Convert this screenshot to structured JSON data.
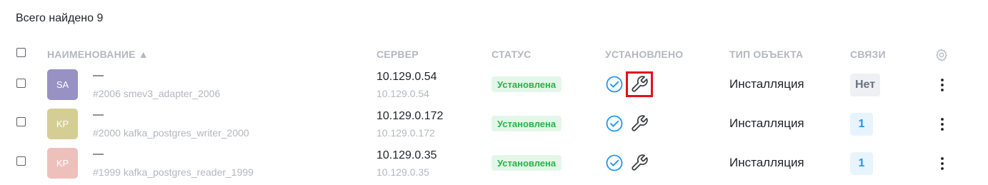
{
  "summary": {
    "total_label": "Всего найдено 9"
  },
  "table": {
    "headers": {
      "name": "НАИМЕНОВАНИЕ ▲",
      "server": "СЕРВЕР",
      "status": "СТАТУС",
      "installed": "УСТАНОВЛЕНО",
      "object_type": "ТИП ОБЪЕКТА",
      "links": "СВЯЗИ"
    },
    "rows": [
      {
        "avatar": "SA",
        "avatar_color": "#9791c4",
        "title": "—",
        "subtitle": "#2006 smev3_adapter_2006",
        "server": "10.129.0.54",
        "server_sub": "10.129.0.54",
        "status": "Установлена",
        "object_type": "Инсталляция",
        "links": "Нет"
      },
      {
        "avatar": "KP",
        "avatar_color": "#d4ce94",
        "title": "—",
        "subtitle": "#2000 kafka_postgres_writer_2000",
        "server": "10.129.0.172",
        "server_sub": "10.129.0.172",
        "status": "Установлена",
        "object_type": "Инсталляция",
        "links": "1"
      },
      {
        "avatar": "KP",
        "avatar_color": "#eec0bb",
        "title": "—",
        "subtitle": "#1999 kafka_postgres_reader_1999",
        "server": "10.129.0.35",
        "server_sub": "10.129.0.35",
        "status": "Установлена",
        "object_type": "Инсталляция",
        "links": "1"
      }
    ]
  },
  "colors": {
    "status_bg": "#e3f7e8",
    "status_text": "#27b347",
    "check_icon": "#2196f3",
    "highlight_border": "#e3101f"
  },
  "icons": {
    "check": "check-circle-icon",
    "wrench": "wrench-icon",
    "settings": "gear-icon",
    "more": "kebab-menu-icon"
  }
}
